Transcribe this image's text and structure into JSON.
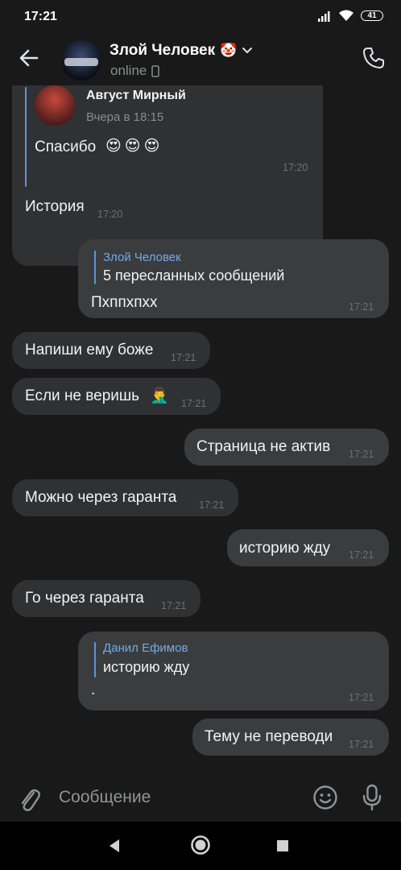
{
  "status_bar": {
    "time": "17:21",
    "battery": "41"
  },
  "header": {
    "name": "Злой Человек",
    "name_emoji": "🤡",
    "status": "online"
  },
  "messages": [
    {
      "dir": "in",
      "fwd_author": "Август Мирный",
      "fwd_time": "Вчера в 18:15",
      "text": "Спасибо",
      "emoji": "😍😍😍",
      "time": "17:20"
    },
    {
      "dir": "in",
      "text": "История",
      "time": "17:20"
    },
    {
      "dir": "out",
      "fwd_author": "Злой Человек",
      "fwd_text": "5 пересланных сообщений",
      "text": "Пхппхпхх",
      "time": "17:21"
    },
    {
      "dir": "in",
      "text": "Напиши ему боже",
      "time": "17:21"
    },
    {
      "dir": "in",
      "text": "Если не веришь",
      "emoji": "🤦‍♂️",
      "time": "17:21"
    },
    {
      "dir": "out",
      "text": "Страница не актив",
      "time": "17:21"
    },
    {
      "dir": "in",
      "text": "Можно через гаранта",
      "time": "17:21"
    },
    {
      "dir": "out",
      "text": "историю жду",
      "time": "17:21"
    },
    {
      "dir": "in",
      "text": "Го через гаранта",
      "time": "17:21"
    },
    {
      "dir": "out",
      "fwd_author": "Данил Ефимов",
      "fwd_text": "историю жду",
      "text": ".",
      "time": "17:21"
    },
    {
      "dir": "out",
      "text": "Тему не переводи",
      "time": "17:21"
    }
  ],
  "composer": {
    "placeholder": "Сообщение"
  },
  "colors": {
    "background": "#19191a",
    "bubble": "#333436",
    "link": "#71aaeb"
  }
}
